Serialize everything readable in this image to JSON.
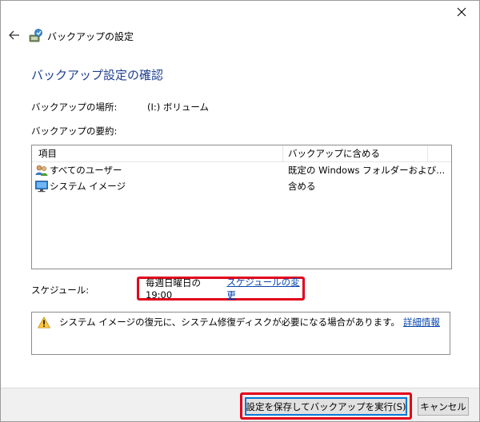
{
  "window": {
    "app_title": "バックアップの設定",
    "close_glyph": "✕",
    "back_glyph": "←"
  },
  "page": {
    "title": "バックアップ設定の確認"
  },
  "location": {
    "label": "バックアップの場所:",
    "value": "(I:) ボリューム"
  },
  "summary": {
    "label": "バックアップの要約:",
    "columns": [
      "項目",
      "バックアップに含める"
    ],
    "rows": [
      {
        "icon": "users-icon",
        "item": "すべてのユーザー",
        "include": "既定の Windows フォルダーおよび..."
      },
      {
        "icon": "monitor-icon",
        "item": "システム イメージ",
        "include": "含める"
      }
    ]
  },
  "schedule": {
    "label": "スケジュール:",
    "value": "毎週日曜日の 19:00",
    "change_link": "スケジュールの変更"
  },
  "warning": {
    "text": "システム イメージの復元に、システム修復ディスクが必要になる場合があります。",
    "link": "詳細情報"
  },
  "buttons": {
    "save_run": "設定を保存してバックアップを実行(S)",
    "cancel": "キャンセル"
  },
  "colors": {
    "accent": "#1e3f8f",
    "highlight": "#e2001a",
    "link": "#0645ad"
  }
}
